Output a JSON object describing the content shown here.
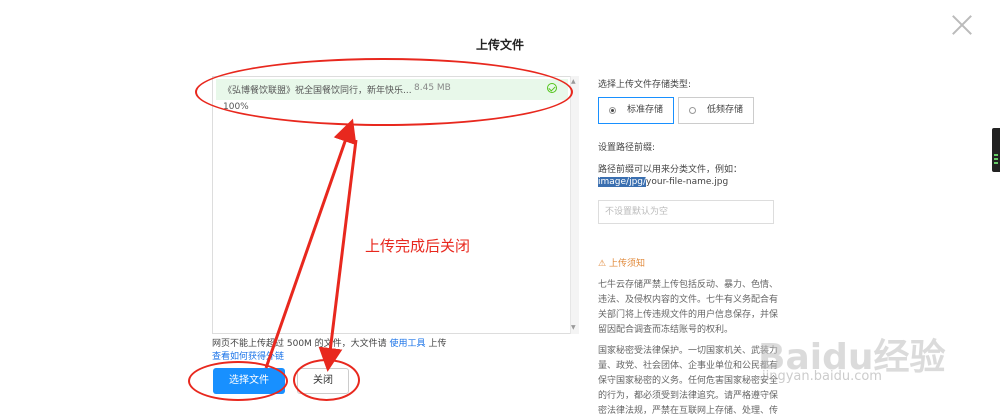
{
  "dialog": {
    "title": "上传文件"
  },
  "upload": {
    "file_name": "《弘博餐饮联盟》祝全国餐饮同行，新年快乐...",
    "file_size": "8.45 MB",
    "progress": "100%",
    "progress_value": 1.0
  },
  "hint": {
    "prefix": "网页不能上传超过 500M 的文件，大文件请",
    "tool_link": "使用工具",
    "suffix": "上传",
    "external_link": "查看如何获得外链"
  },
  "buttons": {
    "select": "选择文件",
    "close": "关闭"
  },
  "annotation": {
    "text": "上传完成后关闭"
  },
  "settings": {
    "storage_label": "选择上传文件存储类型:",
    "storage_options": [
      "标准存储",
      "低频存储"
    ],
    "storage_selected": "标准存储",
    "prefix_label": "设置路径前缀:",
    "prefix_desc": "路径前缀可以用来分类文件，例如：",
    "example_selected": "image/jpg/",
    "example_rest": "your-file-name.jpg",
    "prefix_placeholder": "不设置默认为空",
    "notice_title": "上传须知",
    "notice_p1": "七牛云存储严禁上传包括反动、暴力、色情、违法、及侵权内容的文件。七牛有义务配合有关部门将上传违规文件的用户信息保存，并保留因配合调查而冻结账号的权利。",
    "notice_p2": "国家秘密受法律保护。一切国家机关、武装力量、政党、社会团体、企事业单位和公民都有保守国家秘密的义务。任何危害国家秘密安全的行为，都必须受到法律追究。请严格遵守保密法律法规，严禁在互联网上存储、处理、传"
  },
  "watermark": {
    "main": "Baidu经验",
    "sub": "jingyan.baidu.com"
  },
  "colors": {
    "accent": "#1890ff",
    "annotation": "#e8281e",
    "success": "#52c41a"
  }
}
